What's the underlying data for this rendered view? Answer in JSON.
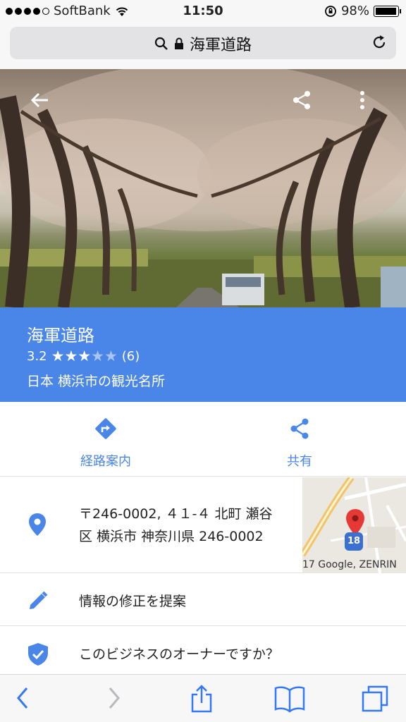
{
  "status_bar": {
    "carrier": "SoftBank",
    "time": "11:50",
    "battery": "98%",
    "battery_level": 0.98
  },
  "url_bar": {
    "title": "海軍道路"
  },
  "place": {
    "name": "海軍道路",
    "rating": "3.2",
    "rating_value": 3.2,
    "review_count": "(6)",
    "category": "日本 横浜市の観光名所"
  },
  "carousel": {
    "count": 5,
    "active_index": 0
  },
  "actions": {
    "directions": "経路案内",
    "share": "共有"
  },
  "address": {
    "line1": "〒246-0002, ４１-４ 北町 瀬谷",
    "line2": "区 横浜市 神奈川県 246-0002",
    "map_copyright": "17 Google, ZENRIN",
    "route_badge": "18"
  },
  "rows": {
    "suggest_edit": "情報の修正を提案",
    "owner": "このビジネスのオーナーですか？"
  },
  "colors": {
    "accent": "#4a86e8",
    "pin_red": "#e53935"
  }
}
